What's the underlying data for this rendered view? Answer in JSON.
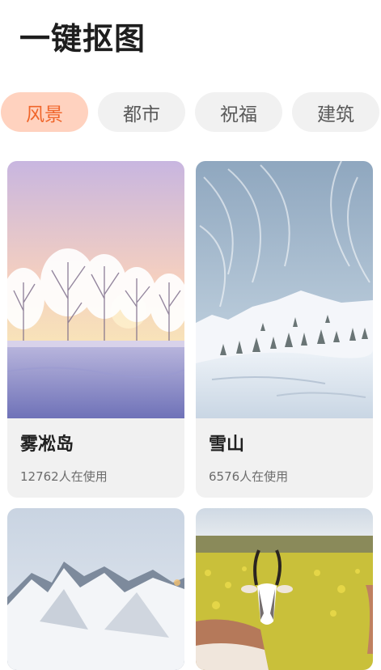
{
  "page": {
    "title": "一键抠图"
  },
  "tabs": [
    {
      "label": "风景",
      "active": true
    },
    {
      "label": "都市",
      "active": false
    },
    {
      "label": "祝福",
      "active": false
    },
    {
      "label": "建筑",
      "active": false
    }
  ],
  "cards": [
    {
      "title": "雾凇岛",
      "usage": "12762人在使用",
      "image": "rime-trees-sunset-snowfield"
    },
    {
      "title": "雪山",
      "usage": "6576人在使用",
      "image": "snow-mountain-blue-sky"
    },
    {
      "title": "",
      "usage": "",
      "image": "snowy-alpine-peaks"
    },
    {
      "title": "",
      "usage": "",
      "image": "antelope-in-flower-field"
    }
  ],
  "colors": {
    "accent": "#f0652a",
    "accent_bg": "#ffd2bf",
    "tab_bg": "#f1f1f1",
    "card_bg": "#f1f1f1"
  }
}
